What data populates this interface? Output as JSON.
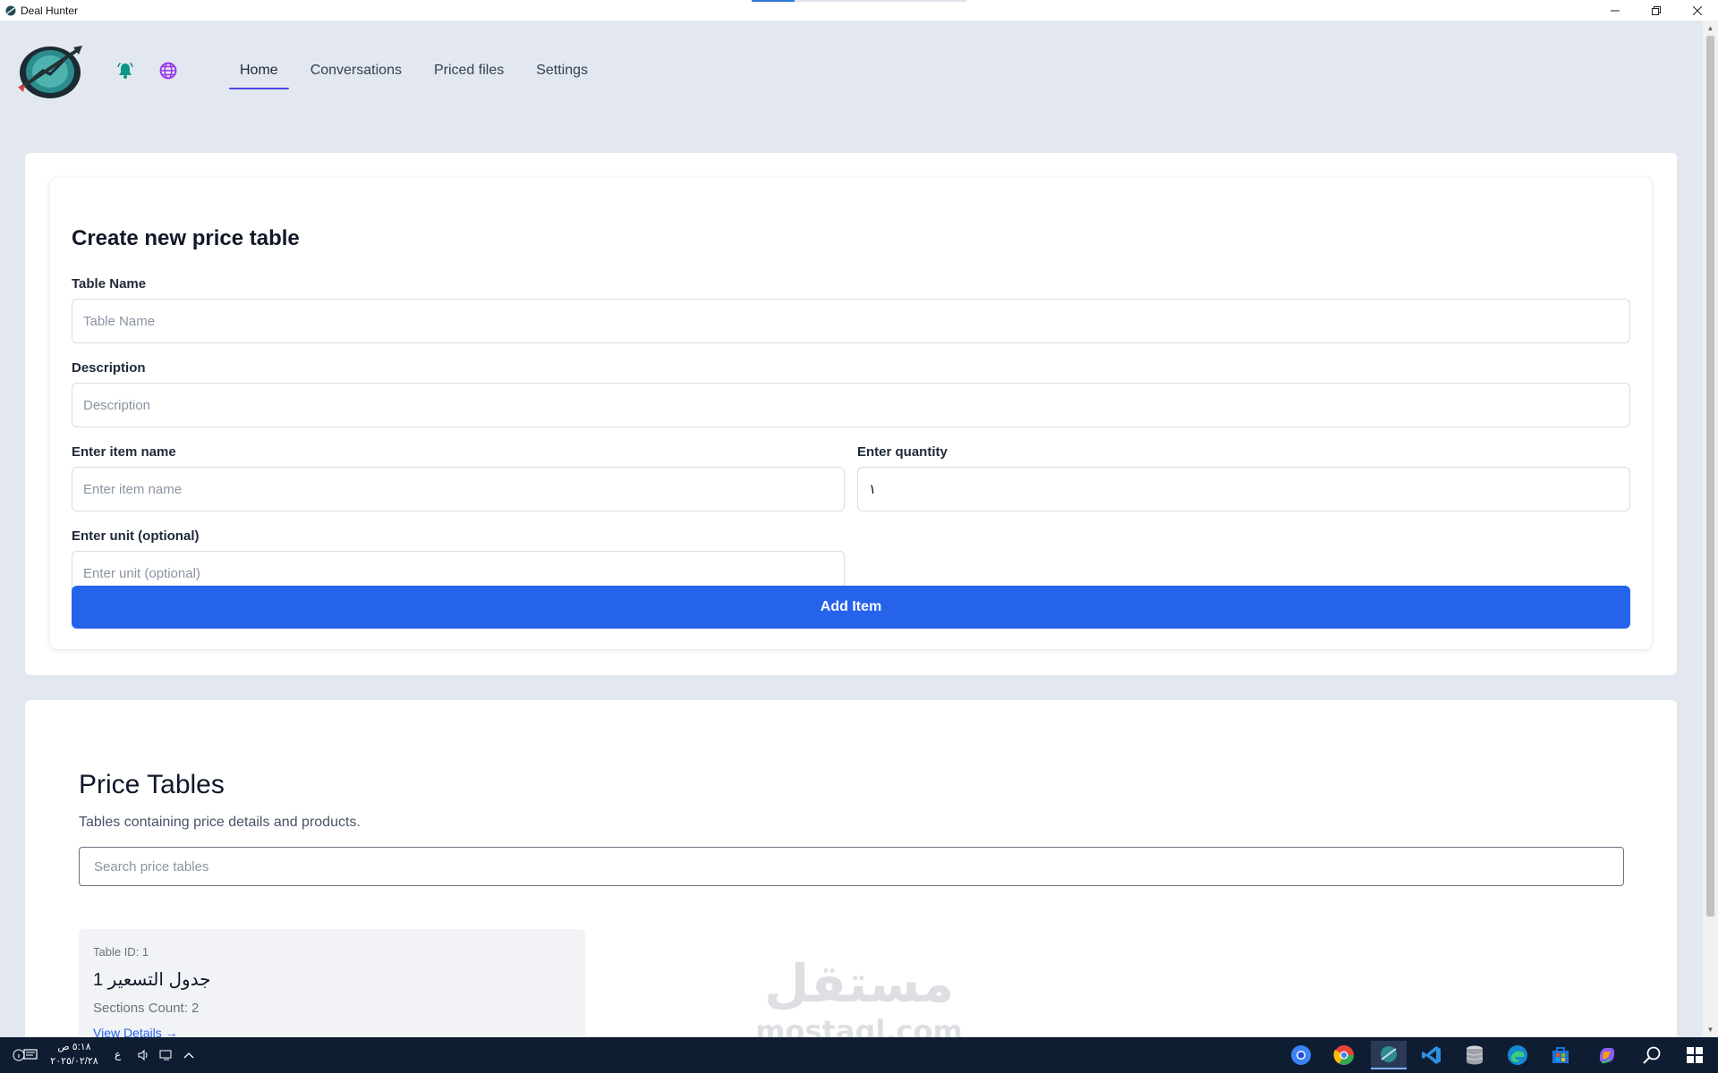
{
  "window": {
    "title": "Deal Hunter"
  },
  "nav": {
    "items": [
      {
        "label": "Home",
        "active": true
      },
      {
        "label": "Conversations",
        "active": false
      },
      {
        "label": "Priced files",
        "active": false
      },
      {
        "label": "Settings",
        "active": false
      }
    ],
    "icons": [
      "bell-icon",
      "globe-icon"
    ]
  },
  "create_form": {
    "title": "Create new price table",
    "table_name": {
      "label": "Table Name",
      "placeholder": "Table Name",
      "value": ""
    },
    "description": {
      "label": "Description",
      "placeholder": "Description",
      "value": ""
    },
    "item_name": {
      "label": "Enter item name",
      "placeholder": "Enter item name",
      "value": ""
    },
    "quantity": {
      "label": "Enter quantity",
      "value": "١"
    },
    "unit": {
      "label": "Enter unit (optional)",
      "placeholder": "Enter unit (optional)",
      "value": ""
    },
    "add_button": "Add Item"
  },
  "price_tables": {
    "title": "Price Tables",
    "subtitle": "Tables containing price details and products.",
    "search_placeholder": "Search price tables",
    "tables": [
      {
        "id_text": "Table ID: 1",
        "name": "جدول التسعير 1",
        "sections_text": "Sections Count: 2",
        "link": "View Details →"
      }
    ]
  },
  "watermark": {
    "text_ar": "مستقل",
    "text_en": "mostaql.com"
  },
  "taskbar": {
    "time": "٥:١٨ ص",
    "date": "٢٠٢٥/٠٢/٢٨",
    "lang": "ع",
    "apps": [
      "chrome-icon",
      "chrome-canary-icon",
      "deal-hunter-icon",
      "vscode-icon",
      "database-icon",
      "edge-icon",
      "store-icon",
      "copilot-icon",
      "search-icon",
      "windows-start-icon"
    ]
  },
  "colors": {
    "accent": "#2563eb",
    "nav_underline": "#4f46e5",
    "page_bg": "#e3e8f0",
    "bell": "#0d9488",
    "globe": "#9333ea",
    "taskbar": "#0f1d33"
  }
}
